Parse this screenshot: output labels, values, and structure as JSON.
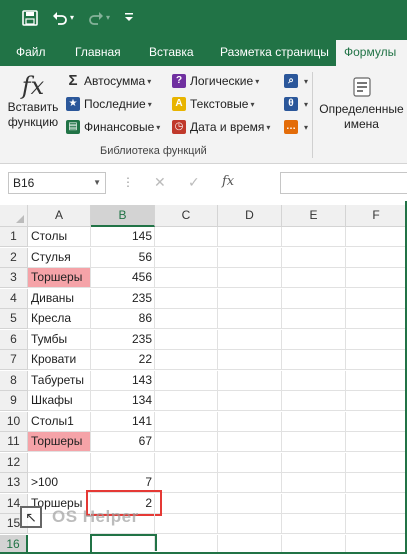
{
  "qat": {
    "save_icon": "save-icon",
    "undo_icon": "undo-icon",
    "redo_icon": "redo-icon",
    "customize_icon": "customize-qat-icon"
  },
  "tabs": [
    "Файл",
    "Главная",
    "Вставка",
    "Разметка страницы",
    "Формулы"
  ],
  "active_tab": "Формулы",
  "ribbon": {
    "insert_function": {
      "icon": "fx",
      "label_line1": "Вставить",
      "label_line2": "функцию"
    },
    "col1": [
      {
        "label": "Автосумма",
        "icon": "sigma-icon",
        "glyph": "Σ"
      },
      {
        "label": "Последние",
        "icon": "star-icon",
        "glyph": "★"
      },
      {
        "label": "Финансовые",
        "icon": "book-icon",
        "glyph": "▤"
      }
    ],
    "col2": [
      {
        "label": "Логические",
        "icon": "logical-book-icon",
        "glyph": "?"
      },
      {
        "label": "Текстовые",
        "icon": "text-book-icon",
        "glyph": "A"
      },
      {
        "label": "Дата и время",
        "icon": "clock-book-icon",
        "glyph": "◷"
      }
    ],
    "col3_icons": [
      "lookup-icon",
      "math-icon",
      "more-functions-icon"
    ],
    "group_label": "Библиотека функций",
    "defined_names": {
      "line1": "Определенные",
      "line2": "имена"
    }
  },
  "formula_bar": {
    "name_box": "B16",
    "cancel_glyph": "✕",
    "enter_glyph": "✓",
    "fx_glyph": "fx",
    "formula": ""
  },
  "columns": [
    "A",
    "B",
    "C",
    "D",
    "E",
    "F"
  ],
  "selected_column": "B",
  "selected_row": "16",
  "rows": [
    {
      "n": "1",
      "a": "Столы",
      "b": "145"
    },
    {
      "n": "2",
      "a": "Стулья",
      "b": "56"
    },
    {
      "n": "3",
      "a": "Торшеры",
      "b": "456",
      "hl": true
    },
    {
      "n": "4",
      "a": "Диваны",
      "b": "235"
    },
    {
      "n": "5",
      "a": "Кресла",
      "b": "86"
    },
    {
      "n": "6",
      "a": "Тумбы",
      "b": "235"
    },
    {
      "n": "7",
      "a": "Кровати",
      "b": "22"
    },
    {
      "n": "8",
      "a": "Табуреты",
      "b": "143"
    },
    {
      "n": "9",
      "a": "Шкафы",
      "b": "134"
    },
    {
      "n": "10",
      "a": "Столы1",
      "b": "141"
    },
    {
      "n": "11",
      "a": "Торшеры",
      "b": "67",
      "hl": true
    },
    {
      "n": "12",
      "a": "",
      "b": ""
    },
    {
      "n": "13",
      "a": ">100",
      "b": "7"
    },
    {
      "n": "14",
      "a": "Торшеры",
      "b": "2",
      "boxed": true
    },
    {
      "n": "15",
      "a": "",
      "b": ""
    },
    {
      "n": "16",
      "a": "",
      "b": ""
    }
  ],
  "colors": {
    "brand": "#217346",
    "highlight": "#f5a3a8",
    "annotation_box": "#e53935"
  },
  "watermark": {
    "text": "OS Helper",
    "icon": "cursor-arrow-icon"
  }
}
